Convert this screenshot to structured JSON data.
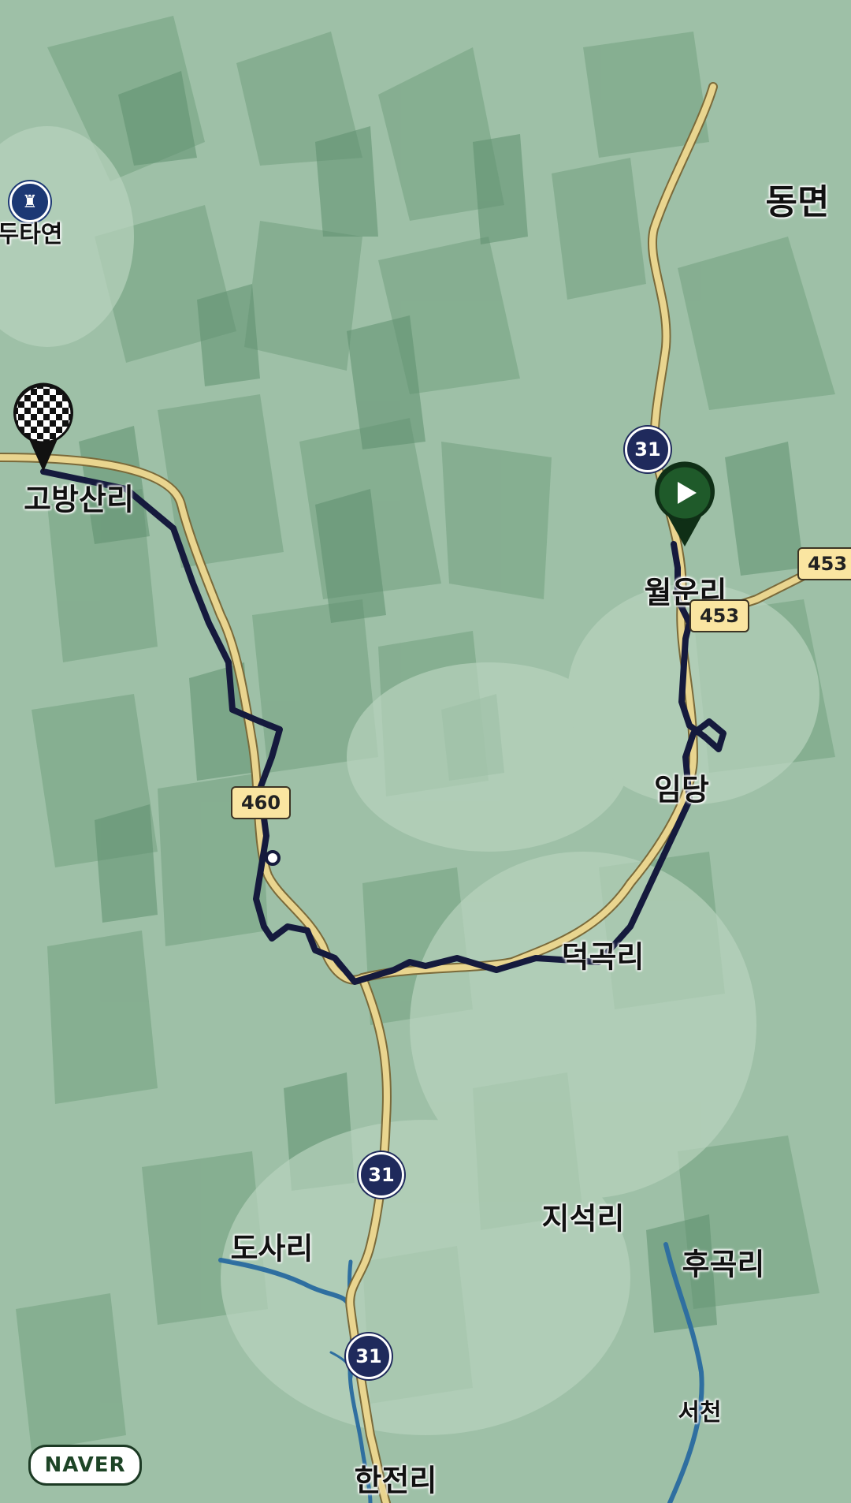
{
  "map": {
    "provider_logo": "NAVER",
    "place_labels": [
      {
        "text": "동면"
      },
      {
        "text": "두타연"
      },
      {
        "text": "고방산리"
      },
      {
        "text": "월운리"
      },
      {
        "text": "임당"
      },
      {
        "text": "덕곡리"
      },
      {
        "text": "지석리"
      },
      {
        "text": "도사리"
      },
      {
        "text": "후곡리"
      },
      {
        "text": "서천"
      },
      {
        "text": "한전리"
      }
    ],
    "national_routes": [
      "31",
      "31",
      "31"
    ],
    "local_routes": [
      "460",
      "453",
      "453"
    ],
    "markers": {
      "start": {
        "icon": "play-icon",
        "color": "#1f5a2a"
      },
      "finish": {
        "icon": "checkered-flag-icon"
      }
    },
    "poi": {
      "icon": "fortress-icon",
      "label": "두타연"
    },
    "colors": {
      "terrain_light": "#a9c8b0",
      "terrain_dark": "#6f9c7d",
      "route_line": "#151a3d",
      "major_road": "#e9d58f",
      "river": "#2f6fa0"
    }
  }
}
